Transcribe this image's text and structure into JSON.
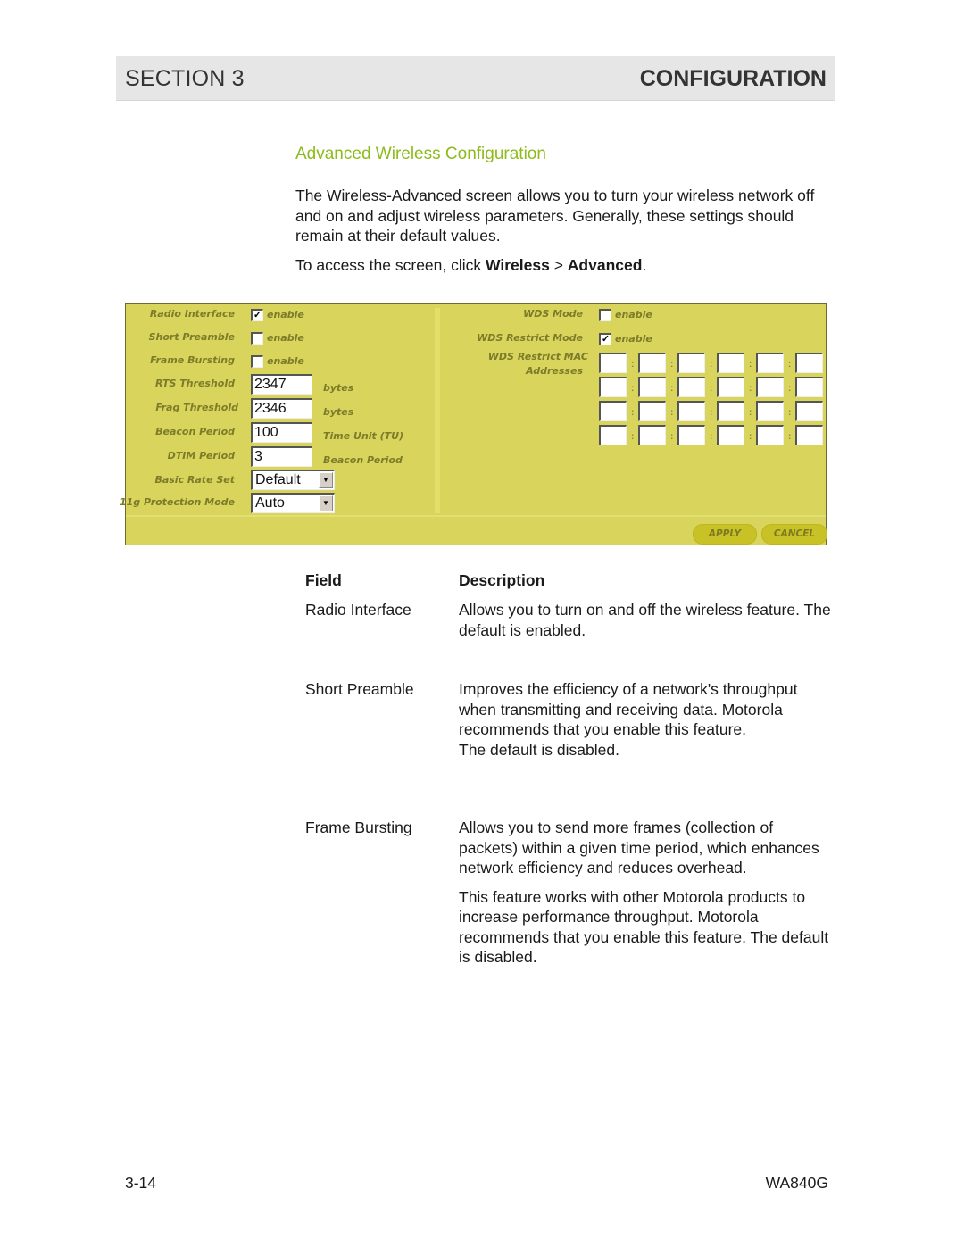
{
  "header": {
    "section": "SECTION 3",
    "chapter": "CONFIGURATION"
  },
  "doc": {
    "title": "Advanced Wireless Configuration",
    "intro": "The Wireless-Advanced screen allows you to turn your wireless network off and on and adjust wireless parameters. Generally, these settings should remain at their default values.",
    "access_prefix": "To access the screen, click ",
    "access_menu": "Wireless",
    "access_sep": " > ",
    "access_item": "Advanced",
    "access_suffix": "."
  },
  "panel": {
    "colors": {
      "background": "#d9d45b",
      "label": "#7c7c2a",
      "button": "#c9c226"
    },
    "left": {
      "radio_interface": {
        "label": "Radio Interface",
        "checked": true,
        "option": "enable"
      },
      "short_preamble": {
        "label": "Short Preamble",
        "checked": false,
        "option": "enable"
      },
      "frame_bursting": {
        "label": "Frame Bursting",
        "checked": false,
        "option": "enable"
      },
      "rts_threshold": {
        "label": "RTS Threshold",
        "value": "2347",
        "unit": "bytes"
      },
      "frag_threshold": {
        "label": "Frag Threshold",
        "value": "2346",
        "unit": "bytes"
      },
      "beacon_period": {
        "label": "Beacon Period",
        "value": "100",
        "unit": "Time Unit (TU)"
      },
      "dtim_period": {
        "label": "DTIM Period",
        "value": "3",
        "unit": "Beacon Period"
      },
      "basic_rate_set": {
        "label": "Basic Rate Set",
        "selected": "Default"
      },
      "protection_mode": {
        "label": "11g Protection Mode",
        "selected": "Auto"
      }
    },
    "right": {
      "wds_mode": {
        "label": "WDS Mode",
        "checked": false,
        "option": "enable"
      },
      "wds_restrict_mode": {
        "label": "WDS Restrict Mode",
        "checked": true,
        "option": "enable"
      },
      "wds_mac_label_1": "WDS Restrict MAC",
      "wds_mac_label_2": "Addresses",
      "mac_rows": 4,
      "mac_octets": 6,
      "mac_separator": ":"
    },
    "buttons": {
      "apply": "APPLY",
      "cancel": "CANCEL"
    }
  },
  "table": {
    "headers": {
      "field": "Field",
      "description": "Description"
    },
    "rows": [
      {
        "field": "Radio Interface",
        "description": [
          "Allows you to turn on and off the wireless feature. The default is enabled."
        ]
      },
      {
        "field": "Short Preamble",
        "description": [
          "Improves the efficiency of a network's throughput when transmitting and receiving data. Motorola recommends that you enable this feature.",
          "The default is disabled."
        ]
      },
      {
        "field": "Frame Bursting",
        "description": [
          "Allows you to send more frames (collection of packets) within a given time period, which enhances network efficiency and reduces overhead.",
          "This feature works with other Motorola products to increase performance throughput. Motorola recommends that you enable this feature. The default is disabled."
        ]
      }
    ]
  },
  "footer": {
    "page": "3-14",
    "model": "WA840G"
  }
}
